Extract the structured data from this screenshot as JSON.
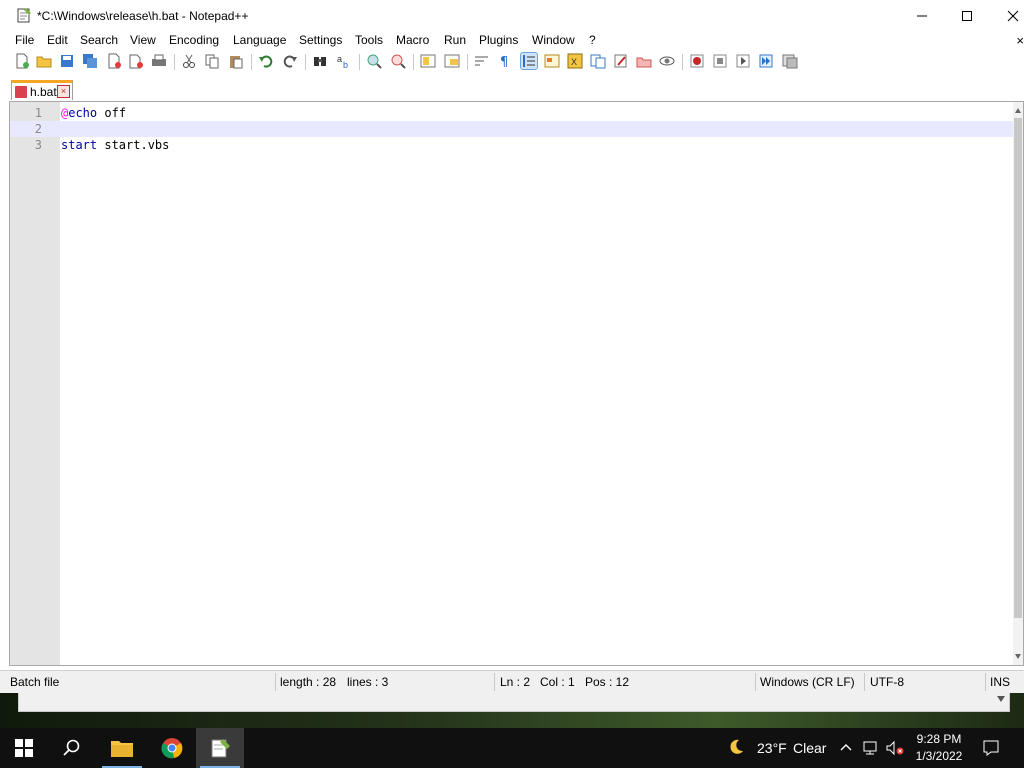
{
  "window": {
    "title": "*C:\\Windows\\release\\h.bat - Notepad++",
    "menu": [
      "File",
      "Edit",
      "Search",
      "View",
      "Encoding",
      "Language",
      "Settings",
      "Tools",
      "Macro",
      "Run",
      "Plugins",
      "Window",
      "?"
    ],
    "menu_close": "×"
  },
  "tab": {
    "label": "h.bat",
    "close": "×"
  },
  "editor": {
    "lines": [
      {
        "num": "1",
        "at": "@",
        "kw": "echo",
        "rest": " off"
      },
      {
        "num": "2",
        "at": "",
        "kw": "",
        "rest": ""
      },
      {
        "num": "3",
        "at": "",
        "kw": "start",
        "rest": " start.vbs"
      }
    ],
    "current_line": 2
  },
  "status": {
    "file_type": "Batch file",
    "length": "length : 28",
    "lines": "lines : 3",
    "ln": "Ln : 2",
    "col": "Col : 1",
    "pos": "Pos : 12",
    "eol": "Windows (CR LF)",
    "encoding": "UTF-8",
    "mode": "INS"
  },
  "taskbar": {
    "weather_temp": "23°F",
    "weather_desc": "Clear",
    "time": "9:28 PM",
    "date": "1/3/2022"
  },
  "colors": {
    "tab_accent": "#f5a623",
    "current_line": "#e8e8ff",
    "keyword": "#0000a0",
    "at_sign": "#ff00ff"
  }
}
